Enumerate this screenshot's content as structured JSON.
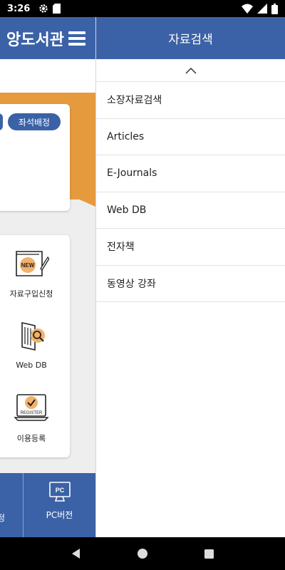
{
  "status_bar": {
    "time": "3:26",
    "icons": [
      "gear-icon",
      "sd-card-icon",
      "wifi-icon",
      "signal-icon",
      "battery-icon"
    ]
  },
  "background_app": {
    "title_partial": "앙도서관",
    "seat_button": "좌석배정",
    "tiles": [
      {
        "label": "자료구입신청",
        "icon": "new-book-icon",
        "badge": "NEW"
      },
      {
        "label": "Web DB",
        "icon": "web-db-icon"
      },
      {
        "label": "이용등록",
        "icon": "register-icon",
        "badge": "REGISTER"
      }
    ],
    "bottom": {
      "left_partial": "정",
      "pc_label": "PC버전",
      "pc_icon_text": "PC"
    }
  },
  "drawer": {
    "title": "자료검색",
    "items": [
      {
        "label": "소장자료검색"
      },
      {
        "label": "Articles"
      },
      {
        "label": "E-Journals"
      },
      {
        "label": "Web DB"
      },
      {
        "label": "전자책"
      },
      {
        "label": "동영상 강좌"
      }
    ]
  },
  "colors": {
    "primary": "#3b62a6",
    "accent": "#e69a3e"
  }
}
